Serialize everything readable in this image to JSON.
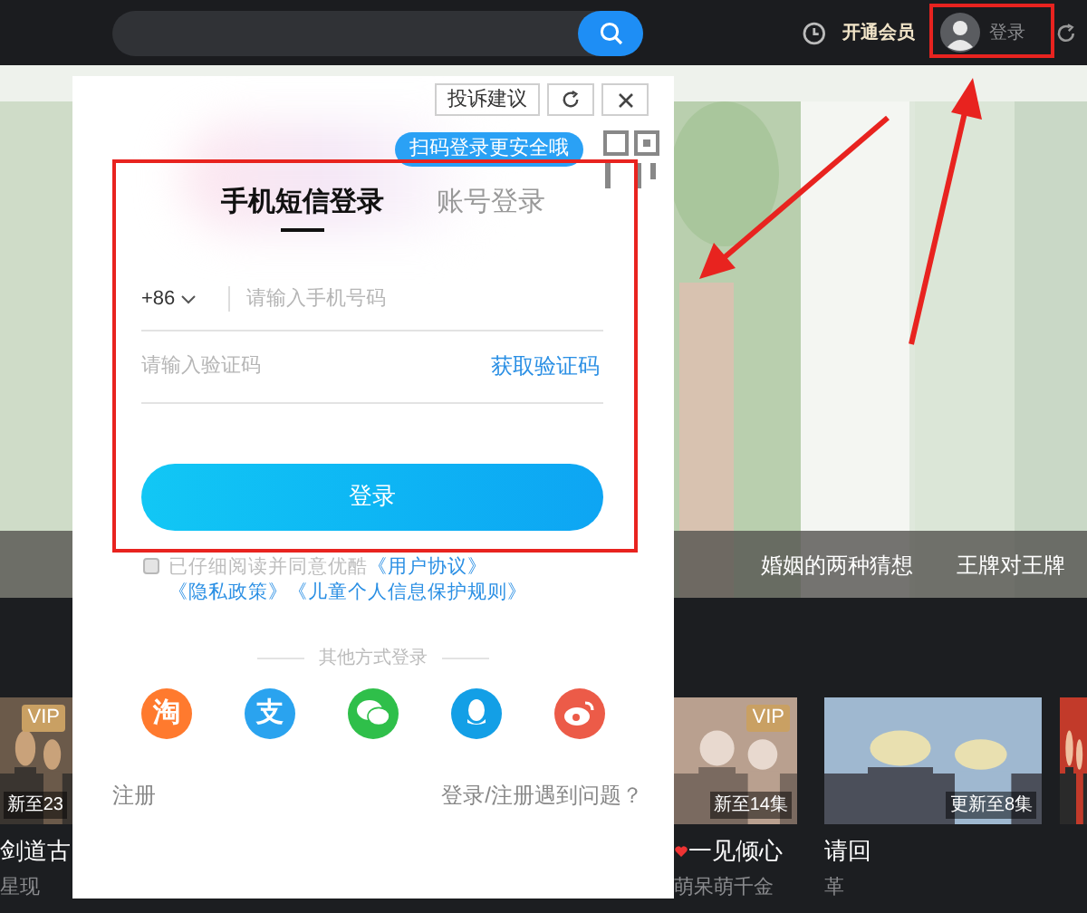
{
  "top_bar": {
    "vip_link": "开通会员",
    "login": "登录"
  },
  "hero": {
    "kind": "picture",
    "captions": [
      "婚姻的两种猜想",
      "王牌对王牌"
    ]
  },
  "cards": [
    {
      "badge": "VIP",
      "episode": "新至23",
      "title": "剑道古",
      "subtitle": "星现"
    },
    {
      "badge": "VIP",
      "episode": "新至14集",
      "title": "一见倾心",
      "subtitle": "萌呆萌千金"
    },
    {
      "episode": "更新至8集",
      "title": "请回",
      "subtitle": "革"
    }
  ],
  "dialog": {
    "feedback_button": "投诉建议",
    "qr_tip": "扫码登录更安全哦",
    "tabs": [
      {
        "label": "手机短信登录",
        "selected": true
      },
      {
        "label": "账号登录",
        "selected": false
      }
    ],
    "country_code": "+86",
    "phone": {
      "placeholder": "请输入手机号码"
    },
    "code": {
      "placeholder": "请输入验证码"
    },
    "get_code": "获取验证码",
    "submit": "登录",
    "agreement": {
      "checked": false,
      "text": "已仔细阅读并同意优酷",
      "links": [
        "《用户协议》",
        "《隐私政策》",
        "《儿童个人信息保护规则》"
      ]
    },
    "other_label": "其他方式登录",
    "providers": [
      {
        "kind": "taobao",
        "glyph": "淘",
        "color": "#ff7a2e"
      },
      {
        "kind": "alipay",
        "glyph": "支",
        "color": "#2aa3ef"
      },
      {
        "kind": "wechat",
        "color": "#2fbf4a"
      },
      {
        "kind": "qq",
        "color": "#139fe6"
      },
      {
        "kind": "weibo",
        "color": "#ec5b48"
      }
    ],
    "register": "注册",
    "help": "登录/注册遇到问题？"
  }
}
